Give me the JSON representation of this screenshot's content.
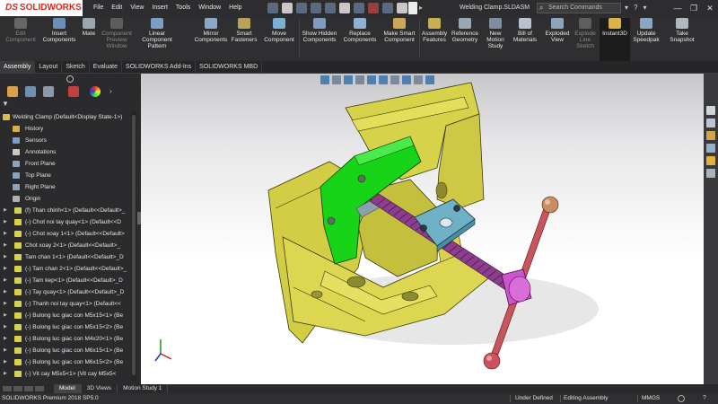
{
  "app": {
    "brand": "SOLIDWORKS",
    "brand_prefix": "DS",
    "document_title": "Welding Clamp.SLDASM",
    "search_placeholder": "Search Commands",
    "menu": [
      "File",
      "Edit",
      "View",
      "Insert",
      "Tools",
      "Window",
      "Help"
    ]
  },
  "ribbon": {
    "buttons": [
      {
        "label": "Edit Component",
        "enabled": false
      },
      {
        "label": "Insert Components",
        "enabled": true
      },
      {
        "label": "Mate",
        "enabled": true
      },
      {
        "label": "Component Preview Window",
        "enabled": false
      },
      {
        "label": "Linear Component Pattern",
        "enabled": true
      },
      {
        "label": "Mirror Components",
        "enabled": true
      },
      {
        "label": "Smart Fasteners",
        "enabled": true
      },
      {
        "label": "Move Component",
        "enabled": true
      },
      {
        "label": "Show Hidden Components",
        "enabled": true
      },
      {
        "label": "Replace Components",
        "enabled": true
      },
      {
        "label": "Make Smart Component",
        "enabled": true
      },
      {
        "label": "Assembly Features",
        "enabled": true
      },
      {
        "label": "Reference Geometry",
        "enabled": true
      },
      {
        "label": "New Motion Study",
        "enabled": true
      },
      {
        "label": "Bill of Materials",
        "enabled": true
      },
      {
        "label": "Exploded View",
        "enabled": true
      },
      {
        "label": "Explode Line Sketch",
        "enabled": false
      },
      {
        "label": "Instant3D",
        "enabled": true,
        "active": true
      },
      {
        "label": "Update Speedpak",
        "enabled": true
      },
      {
        "label": "Take Snapshot",
        "enabled": true
      }
    ]
  },
  "command_tabs": [
    "Assembly",
    "Layout",
    "Sketch",
    "Evaluate",
    "SOLIDWORKS Add-Ins",
    "SOLIDWORKS MBD"
  ],
  "active_command_tab": "Assembly",
  "feature_tree": {
    "root": "Welding Clamp  (Default<Display State-1>)",
    "items": [
      {
        "label": "History",
        "kind": "folder"
      },
      {
        "label": "Sensors",
        "kind": "sensor"
      },
      {
        "label": "Annotations",
        "kind": "annotation"
      },
      {
        "label": "Front Plane",
        "kind": "plane"
      },
      {
        "label": "Top Plane",
        "kind": "plane"
      },
      {
        "label": "Right Plane",
        "kind": "plane"
      },
      {
        "label": "Origin",
        "kind": "origin"
      },
      {
        "label": "(f) Than chinh<1> (Default<<Default>_",
        "kind": "part"
      },
      {
        "label": "(-) Chot noi tay quay<1> (Default<<D",
        "kind": "part"
      },
      {
        "label": "(-) Chot xoay 1<1> (Default<<Default>",
        "kind": "part"
      },
      {
        "label": "Chot xoay 2<1> (Default<<Default>_",
        "kind": "part"
      },
      {
        "label": "Tam chan 1<1> (Default<<Default>_D",
        "kind": "part"
      },
      {
        "label": "(-) Tam chan 2<1> (Default<<Default>_",
        "kind": "part"
      },
      {
        "label": "(-) Tam kep<1> (Default<<Default>_D",
        "kind": "part"
      },
      {
        "label": "(-) Tay quay<1> (Default<<Default>_D",
        "kind": "part"
      },
      {
        "label": "(-) Thanh noi tay quay<1> (Default<<",
        "kind": "part"
      },
      {
        "label": "(-) Bulong luc giac con M5x15<1> (Be",
        "kind": "part"
      },
      {
        "label": "(-) Bulong luc giac con M5x15<2> (Be",
        "kind": "part"
      },
      {
        "label": "(-) Bulong luc giac con M4x20<1> (Be",
        "kind": "part"
      },
      {
        "label": "(-) Bulong luc giac con M6x15<1> (Be",
        "kind": "part"
      },
      {
        "label": "(-) Bulong luc giac con M6x15<2> (Be",
        "kind": "part"
      },
      {
        "label": "(-) Vit cay M5x5<1> (Vit cay M5x5<",
        "kind": "part"
      }
    ]
  },
  "model_tabs": [
    "Model",
    "3D Views",
    "Motion Study 1"
  ],
  "active_model_tab": "Model",
  "status": {
    "product": "SOLIDWORKS Premium 2018 SP5.0",
    "definition": "Under Defined",
    "mode": "Editing Assembly",
    "units": "MMGS"
  },
  "colors": {
    "body": "#d6d24a",
    "clamp_jaw": "#18d418",
    "screw": "#8c3e8c",
    "handle": "#c9545e",
    "ball": "#c98d63",
    "collar": "#cc55cc",
    "plate": "#6fb0c4"
  }
}
